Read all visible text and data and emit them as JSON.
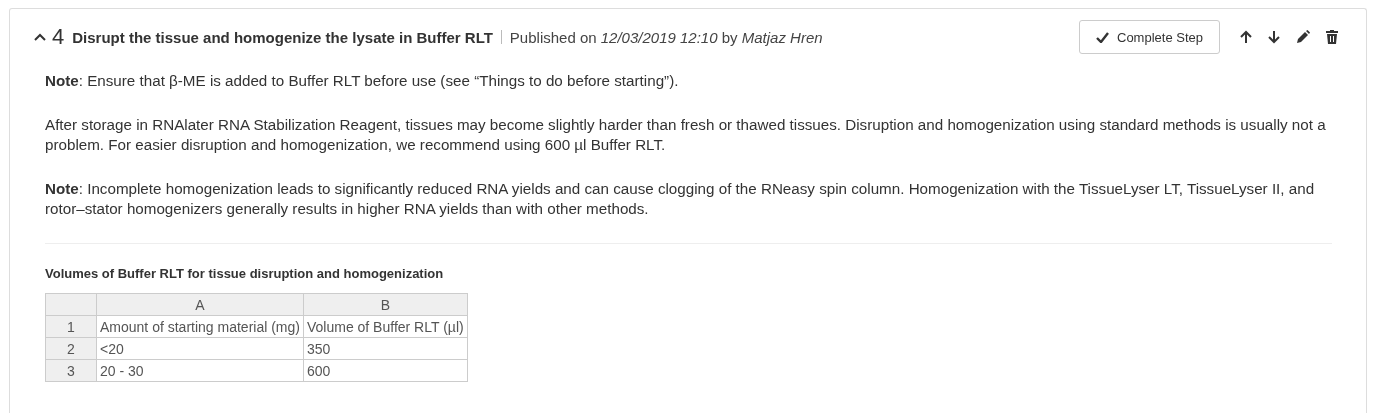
{
  "step": {
    "expanded": true,
    "number": "4",
    "title": "Disrupt the tissue and homogenize the lysate in Buffer RLT",
    "published_label": "Published on",
    "published_date": "12/03/2019 12:10",
    "by_label": "by",
    "author": "Matjaz Hren"
  },
  "actions": {
    "complete_button": "Complete Step"
  },
  "paragraphs": [
    "**Note**: Ensure that β-ME is added to Buffer RLT before use (see “Things to do before starting”).",
    "After storage in RNAlater RNA Stabilization Reagent, tissues may become slightly harder than fresh or thawed tissues. Disruption and homogenization using standard methods is usually not a problem. For easier disruption and homogenization, we recommend using 600 µl Buffer RLT.",
    "**Note**: Incomplete homogenization leads to significantly reduced RNA yields and can cause clogging of the RNeasy spin column. Homogenization with the TissueLyser LT, TissueLyser II, and rotor–stator homogenizers generally results in higher RNA yields than with other methods."
  ],
  "table": {
    "caption": "Volumes of Buffer RLT for tissue disruption and homogenization",
    "columns": [
      "A",
      "B"
    ],
    "rows": [
      {
        "index": "1",
        "cells": [
          "Amount of starting material (mg)",
          "Volume of Buffer RLT (µl)"
        ]
      },
      {
        "index": "2",
        "cells": [
          "<20",
          "350"
        ]
      },
      {
        "index": "3",
        "cells": [
          "20 - 30",
          "600"
        ]
      }
    ]
  }
}
